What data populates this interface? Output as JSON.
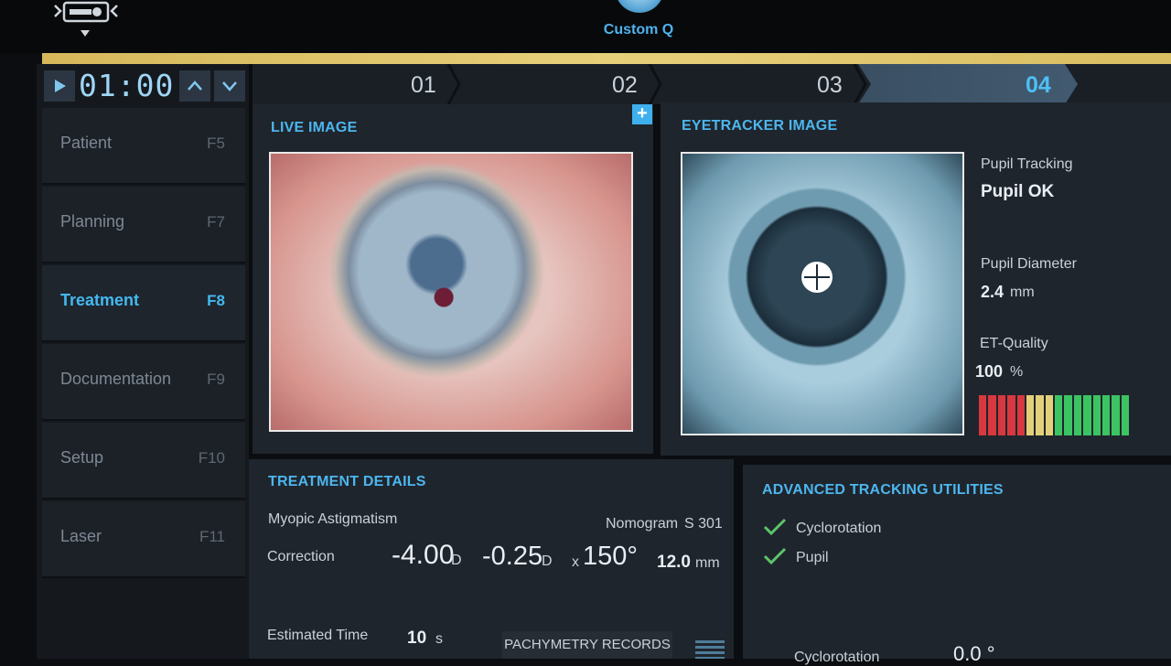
{
  "header": {
    "profile_name": "Custom Q"
  },
  "timer": {
    "value": "01:00"
  },
  "nav": {
    "items": [
      {
        "label": "Patient",
        "key": "F5"
      },
      {
        "label": "Planning",
        "key": "F7"
      },
      {
        "label": "Treatment",
        "key": "F8",
        "active": true
      },
      {
        "label": "Documentation",
        "key": "F9"
      },
      {
        "label": "Setup",
        "key": "F10"
      },
      {
        "label": "Laser",
        "key": "F11"
      }
    ]
  },
  "steps": {
    "tabs": [
      "01",
      "02",
      "03",
      "04"
    ],
    "active": "04"
  },
  "live_image": {
    "title": "LIVE IMAGE",
    "add_symbol": "+"
  },
  "eyetracker": {
    "title": "EYETRACKER IMAGE",
    "pupil_tracking_label": "Pupil Tracking",
    "pupil_tracking_value": "Pupil OK",
    "pupil_diameter_label": "Pupil Diameter",
    "pupil_diameter_value": "2.4",
    "pupil_diameter_unit": "mm",
    "et_quality_label": "ET-Quality",
    "et_quality_value": "100",
    "et_quality_unit": "%",
    "quality_level": 1.0,
    "bar_colors": [
      "#d8383f",
      "#d8383f",
      "#d8383f",
      "#d8383f",
      "#d8383f",
      "#e3d07a",
      "#e3d07a",
      "#e3d07a",
      "#3cc463",
      "#3cc463",
      "#3cc463",
      "#3cc463",
      "#3cc463",
      "#3cc463",
      "#3cc463",
      "#3cc463"
    ]
  },
  "treatment": {
    "title": "TREATMENT DETAILS",
    "diagnosis": "Myopic Astigmatism",
    "nomogram_label": "Nomogram",
    "nomogram_value": "S 301",
    "correction_label": "Correction",
    "sphere": "-4.00",
    "sphere_unit": "D",
    "cylinder": "-0.25",
    "cylinder_unit": "D",
    "axis_prefix": "x",
    "axis": "150°",
    "zone": "12.0",
    "zone_unit": "mm",
    "estimated_time_label": "Estimated Time",
    "estimated_time_value": "10",
    "estimated_time_unit": "s",
    "pachymetry_button": "PACHYMETRY RECORDS"
  },
  "tracking": {
    "title": "ADVANCED TRACKING UTILITIES",
    "items": [
      "Cyclorotation",
      "Pupil"
    ],
    "cyclorotation_label": "Cyclorotation",
    "cyclorotation_value": "0.0 °"
  },
  "colors": {
    "accent": "#4cb6ef",
    "highlight_bar": "#e2c86c"
  }
}
